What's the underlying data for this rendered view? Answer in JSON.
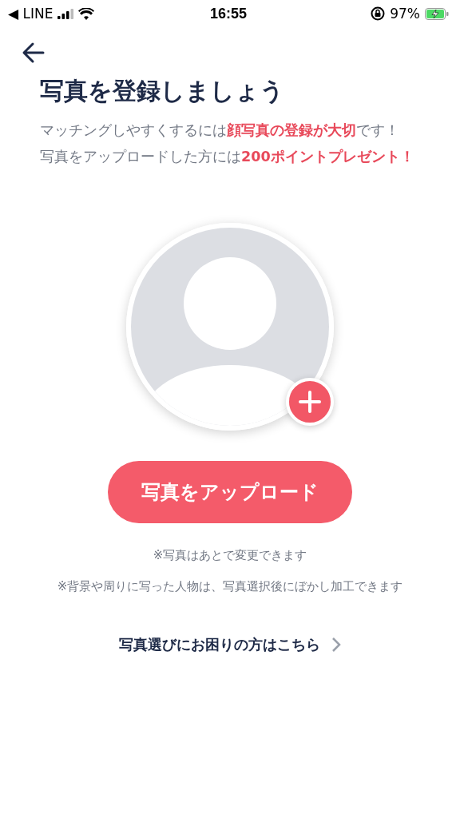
{
  "status_bar": {
    "back_app": "◀ LINE",
    "time": "16:55",
    "battery": "97%"
  },
  "title": "写真を登録しましょう",
  "description": [
    "マッチングしやすくするには**顔写真の登録が大切**です！",
    "写真をアップロードした方には**200ポイントプレゼント！**"
  ],
  "upload_button": "写真をアップロード",
  "notes": [
    "※写真はあとで変更できます",
    "※背景や周りに写った人物は、写真選択後にぼかし加工できます"
  ],
  "help_link": "写真選びにお困りの方はこちら"
}
